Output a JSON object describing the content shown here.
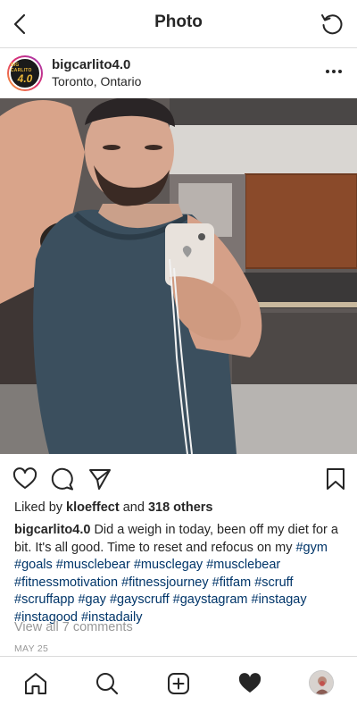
{
  "header": {
    "title": "Photo",
    "back_icon": "chevron-left-icon",
    "refresh_icon": "refresh-icon"
  },
  "post": {
    "avatar_text_small": "BIG CARLITO",
    "avatar_text_big": "4.0",
    "username": "bigcarlito4.0",
    "location": "Toronto, Ontario",
    "more_icon": "more-icon"
  },
  "actions": {
    "like_icon": "heart-outline-icon",
    "comment_icon": "comment-icon",
    "share_icon": "send-icon",
    "save_icon": "bookmark-icon"
  },
  "likes": {
    "prefix": "Liked by",
    "user": "kloeffect",
    "and": "and",
    "others": "318 others"
  },
  "caption": {
    "username": "bigcarlito4.0",
    "text": "Did a weigh in today, been off my diet for a bit. It's all good. Time to reset and refocus on my",
    "hashtags": [
      "#gym",
      "#goals",
      "#musclebear",
      "#musclegay",
      "#musclebear",
      "#fitnessmotivation",
      "#fitnessjourney",
      "#fitfam",
      "#scruff",
      "#scruffapp",
      "#gay",
      "#gayscruff",
      "#gaystagram",
      "#instagay",
      "#instagood",
      "#instadaily"
    ]
  },
  "comments_link": "View all 7 comments",
  "date": "MAY 25",
  "nav": {
    "home_icon": "home-icon",
    "search_icon": "search-icon",
    "add_icon": "add-post-icon",
    "activity_icon": "heart-filled-icon",
    "profile_icon": "profile-avatar-icon"
  },
  "colors": {
    "hashtag": "#003569",
    "muted": "#999999",
    "text": "#262626",
    "divider": "#dbdbdb"
  }
}
